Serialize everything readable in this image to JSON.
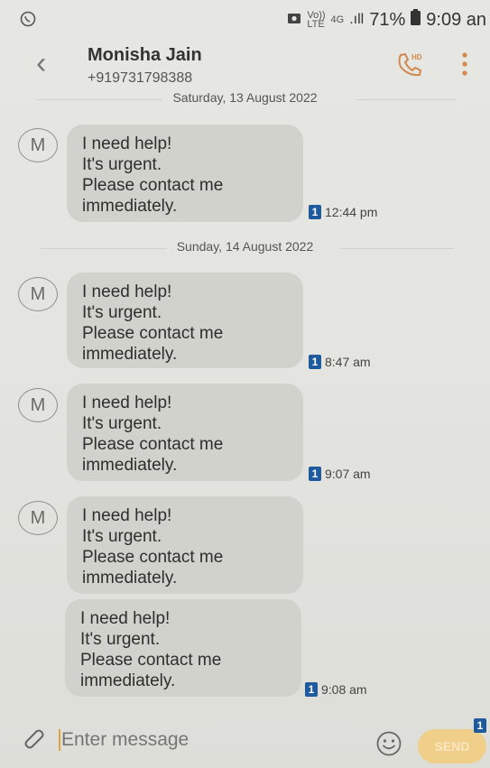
{
  "status": {
    "app_icon": "whatsapp-icon",
    "volte": "Vo))",
    "lte": "LTE",
    "network": "4G",
    "signal": ".ıll",
    "battery": "71%",
    "battery_icon": "battery-icon",
    "time": "9:09 an"
  },
  "header": {
    "back_icon": "back-chevron-icon",
    "name": "Monisha Jain",
    "number": "+919731798388",
    "call_icon": "hd-call-icon",
    "call_badge": "HD",
    "more_icon": "more-vertical-icon"
  },
  "dates": [
    "Saturday, 13 August 2022",
    "Sunday, 14 August 2022"
  ],
  "messages": [
    {
      "avatar": "M",
      "lines": [
        "I need help!",
        "It's urgent.",
        "Please contact me",
        "immediately."
      ],
      "sim": "1",
      "time": "12:44 pm"
    },
    {
      "avatar": "M",
      "lines": [
        "I need help!",
        "It's urgent.",
        "Please contact me",
        "immediately."
      ],
      "sim": "1",
      "time": "8:47 am"
    },
    {
      "avatar": "M",
      "lines": [
        "I need help!",
        "It's urgent.",
        "Please contact me",
        "immediately."
      ],
      "sim": "1",
      "time": "9:07 am"
    },
    {
      "avatar": "M",
      "lines": [
        "I need help!",
        "It's urgent.",
        "Please contact me",
        "immediately."
      ]
    },
    {
      "lines": [
        "I need help!",
        "It's urgent.",
        "Please contact me",
        "immediately."
      ],
      "sim": "1",
      "time": "9:08 am"
    }
  ],
  "composer": {
    "attach_icon": "paperclip-icon",
    "placeholder": "Enter message",
    "emoji_icon": "smiley-icon",
    "send_label": "SEND",
    "send_sim": "1"
  },
  "colors": {
    "sim_badge": "#1f5a9c",
    "send_button": "#f0cf8a",
    "bubble": "#d2d2cd",
    "background": "#e4e4e0"
  }
}
